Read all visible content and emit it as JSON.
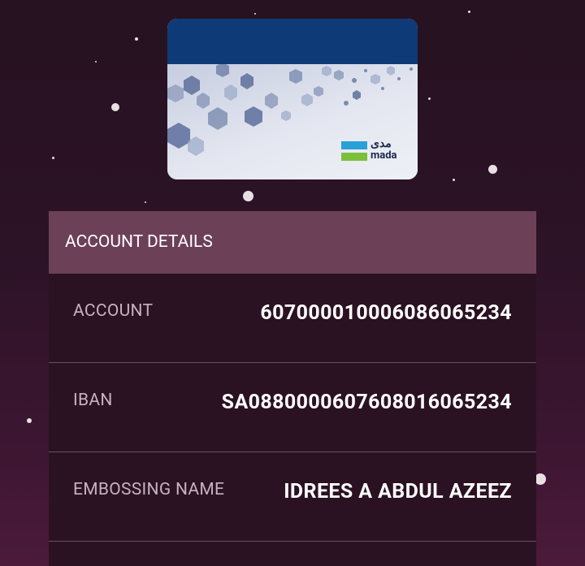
{
  "card": {
    "brand_arabic": "مدى",
    "brand_latin": "mada",
    "colors": {
      "top": "#0e3a78",
      "mada_blue": "#2aa0d8",
      "mada_green": "#7bbf3a"
    }
  },
  "account_details": {
    "header": "ACCOUNT DETAILS",
    "rows": [
      {
        "label": "ACCOUNT",
        "value": "6070000100060860652 34"
      },
      {
        "label": "IBAN",
        "value": "SA0880000607608016065234"
      },
      {
        "label": "EMBOSSING NAME",
        "value": "IDREES A ABDUL AZEEZ"
      }
    ]
  },
  "colors": {
    "header_bg": "#6c4158",
    "row_bg": "#2b1222",
    "divider": "#6a4f5f"
  }
}
